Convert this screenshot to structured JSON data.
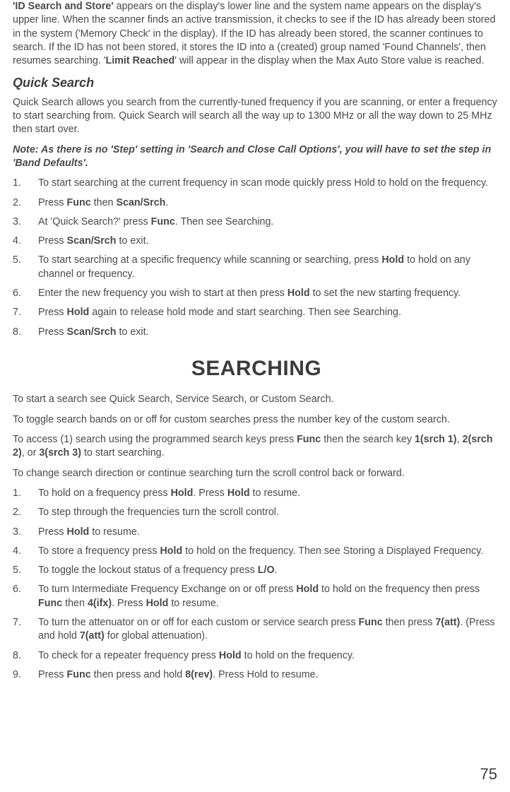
{
  "intro_p": [
    {
      "t": "'ID Search and Store'",
      "bold": true
    },
    {
      "t": " appears on the display's lower line and the system name appears on the display's upper line. When the scanner finds an active transmission, it checks to see if the ID has already been stored in the system ('Memory Check' in the display). If the ID has already been stored, the scanner continues to search. If the ID has not been stored, it stores the ID into a (created) group named 'Found Channels', then resumes searching. '"
    },
    {
      "t": "Limit Reached",
      "bold": true
    },
    {
      "t": "' will appear in the display when the Max Auto Store value is reached."
    }
  ],
  "quicksearch_heading": "Quick Search",
  "quicksearch_p1": "Quick Search allows you search from the currently-tuned frequency if you are scanning, or enter a frequency to start searching from. Quick Search will search all the way up to 1300 MHz or all the way down to 25 MHz then start over.",
  "quicksearch_note": "Note: As there is no 'Step' setting in 'Search and Close Call Options', you will have to set the step in 'Band Defaults'.",
  "qs_list": [
    [
      {
        "t": "To start searching at the current frequency in scan mode quickly press Hold to hold on the frequency."
      }
    ],
    [
      {
        "t": "Press "
      },
      {
        "t": "Func",
        "bold": true
      },
      {
        "t": " then "
      },
      {
        "t": "Scan/Srch",
        "bold": true
      },
      {
        "t": "."
      }
    ],
    [
      {
        "t": "At 'Quick Search?' press "
      },
      {
        "t": "Func",
        "bold": true
      },
      {
        "t": ". Then see Searching."
      }
    ],
    [
      {
        "t": "Press "
      },
      {
        "t": "Scan/Srch",
        "bold": true
      },
      {
        "t": " to exit."
      }
    ],
    [
      {
        "t": "To start searching at a specific frequency while scanning or searching, press "
      },
      {
        "t": "Hold",
        "bold": true
      },
      {
        "t": " to hold on any channel or frequency."
      }
    ],
    [
      {
        "t": "Enter the new frequency you wish to start at then press "
      },
      {
        "t": "Hold",
        "bold": true
      },
      {
        "t": " to set the new starting frequency."
      }
    ],
    [
      {
        "t": "Press "
      },
      {
        "t": "Hold",
        "bold": true
      },
      {
        "t": " again to release hold mode and start searching. Then see Searching."
      }
    ],
    [
      {
        "t": "Press "
      },
      {
        "t": "Scan/Srch",
        "bold": true
      },
      {
        "t": " to exit."
      }
    ]
  ],
  "searching_heading": "SEARCHING",
  "searching_p1": "To start a search see Quick Search, Service Search, or Custom Search.",
  "searching_p2": "To toggle search bands on or off for custom searches press the number key of the custom search.",
  "searching_p3": [
    {
      "t": "To access (1) search using the programmed search keys press "
    },
    {
      "t": "Func",
      "bold": true
    },
    {
      "t": " then the search key "
    },
    {
      "t": "1(srch 1)",
      "bold": true
    },
    {
      "t": ", "
    },
    {
      "t": "2(srch 2)",
      "bold": true
    },
    {
      "t": ", or "
    },
    {
      "t": "3(srch 3)",
      "bold": true
    },
    {
      "t": " to start searching."
    }
  ],
  "searching_p4": "To change search direction or continue searching turn the scroll control back or forward.",
  "s_list": [
    [
      {
        "t": "To hold on a frequency press "
      },
      {
        "t": "Hold",
        "bold": true
      },
      {
        "t": ". Press "
      },
      {
        "t": "Hold",
        "bold": true
      },
      {
        "t": " to resume."
      }
    ],
    [
      {
        "t": " To step through the frequencies turn the scroll control."
      }
    ],
    [
      {
        "t": "Press "
      },
      {
        "t": "Hold",
        "bold": true
      },
      {
        "t": " to resume."
      }
    ],
    [
      {
        "t": "To store a frequency press "
      },
      {
        "t": "Hold",
        "bold": true
      },
      {
        "t": " to hold on the frequency. Then see Storing a Displayed Frequency."
      }
    ],
    [
      {
        "t": "To toggle the lockout status of a frequency press "
      },
      {
        "t": "L/O",
        "bold": true
      },
      {
        "t": "."
      }
    ],
    [
      {
        "t": "To turn Intermediate Frequency Exchange on or off press "
      },
      {
        "t": "Hold",
        "bold": true
      },
      {
        "t": " to hold on the frequency then press "
      },
      {
        "t": "Func",
        "bold": true
      },
      {
        "t": " then "
      },
      {
        "t": "4(ifx)",
        "bold": true
      },
      {
        "t": ". Press "
      },
      {
        "t": "Hold",
        "bold": true
      },
      {
        "t": " to resume."
      }
    ],
    [
      {
        "t": "To turn the attenuator on or off for each custom or service search press "
      },
      {
        "t": "Func",
        "bold": true
      },
      {
        "t": " then press "
      },
      {
        "t": "7(att)",
        "bold": true
      },
      {
        "t": ". (Press and hold "
      },
      {
        "t": "7(att)",
        "bold": true
      },
      {
        "t": " for global attenuation)."
      }
    ],
    [
      {
        "t": "To check for a repeater frequency press "
      },
      {
        "t": "Hold",
        "bold": true
      },
      {
        "t": " to hold on the frequency."
      }
    ],
    [
      {
        "t": "Press "
      },
      {
        "t": "Func",
        "bold": true
      },
      {
        "t": " then press and hold "
      },
      {
        "t": "8(rev)",
        "bold": true
      },
      {
        "t": ". Press Hold to resume."
      }
    ]
  ],
  "page_number": "75"
}
